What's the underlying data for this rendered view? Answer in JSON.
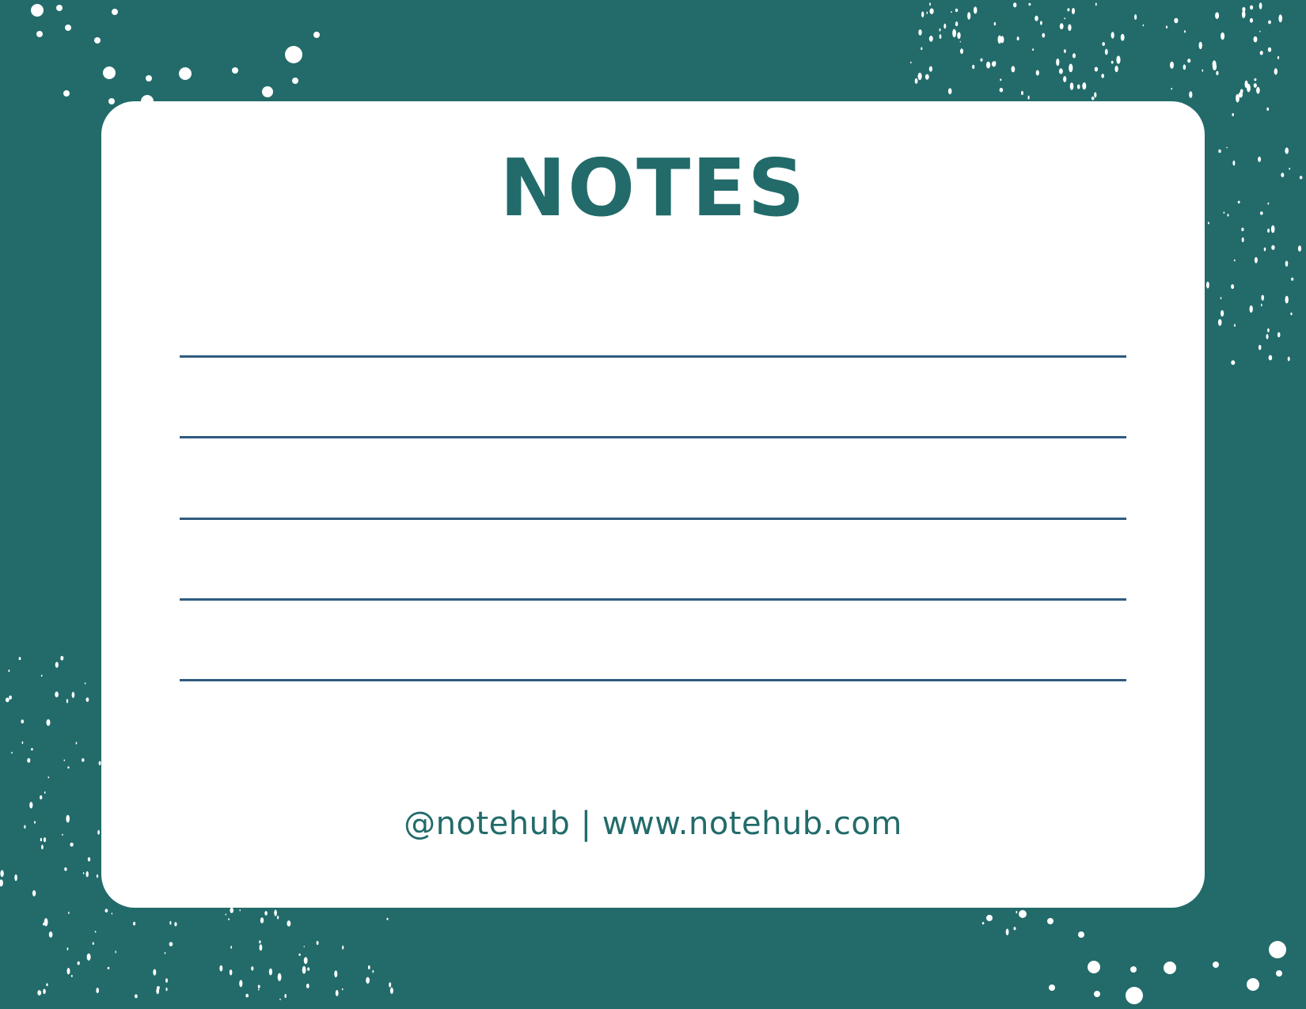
{
  "title": "NOTES",
  "footer": "@notehub | www.notehub.com",
  "ruled_line_count": 5,
  "colors": {
    "background": "#226b6a",
    "card": "#ffffff",
    "accent": "#226b6a",
    "rule": "#2f5a80",
    "speckle": "#ffffff"
  }
}
